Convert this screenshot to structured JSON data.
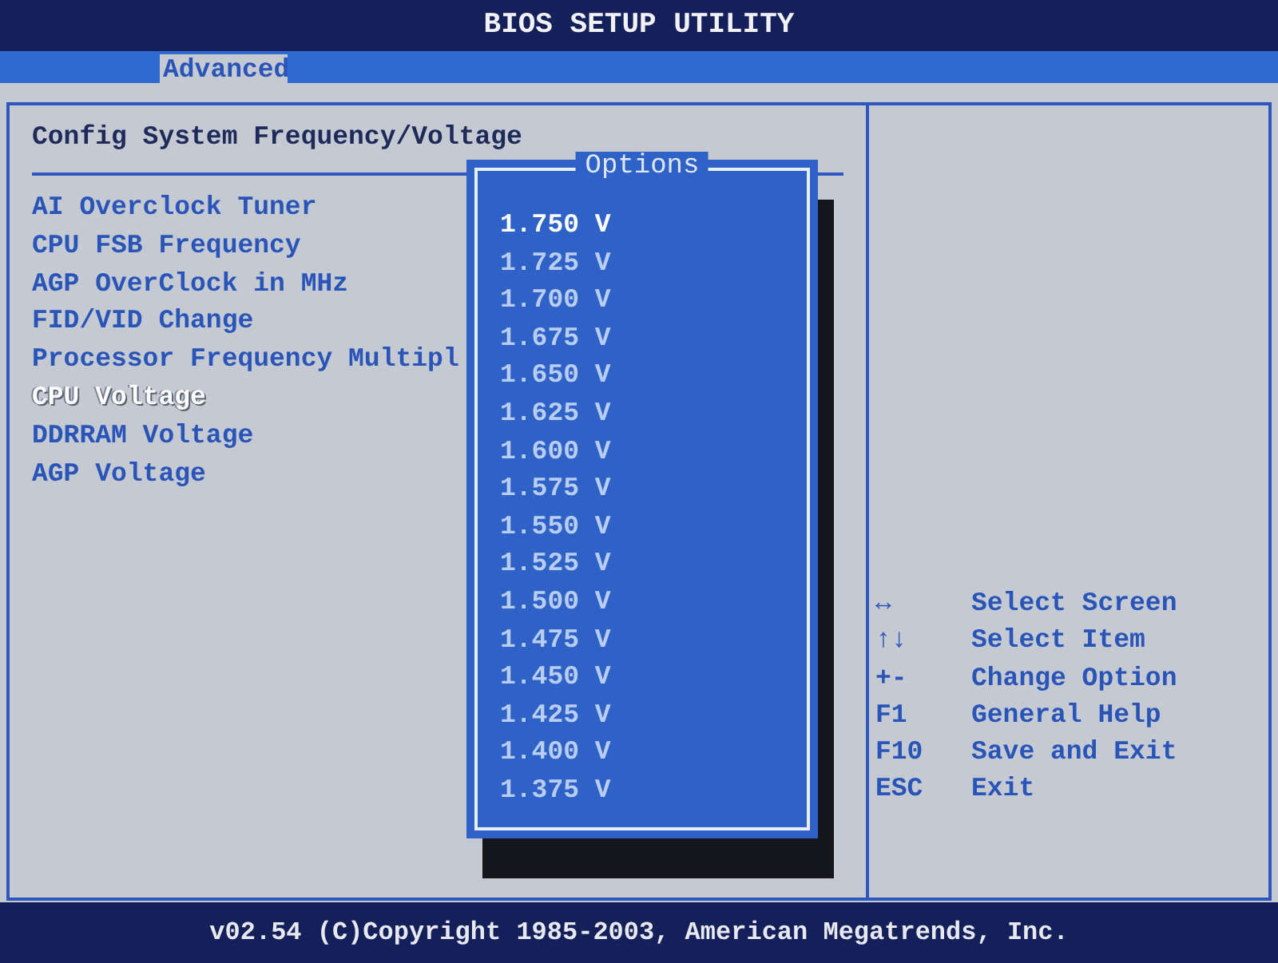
{
  "window": {
    "title": "BIOS SETUP UTILITY"
  },
  "tabs": [
    {
      "label": "Advanced",
      "selected": true
    }
  ],
  "section": {
    "title": "Config System Frequency/Voltage"
  },
  "menu_items": [
    {
      "label": "AI Overclock Tuner",
      "selected": false
    },
    {
      "label": "CPU FSB Frequency",
      "selected": false
    },
    {
      "label": "AGP OverClock in MHz",
      "selected": false
    },
    {
      "label": "FID/VID Change",
      "selected": false
    },
    {
      "label": "Processor Frequency Multipl",
      "selected": false
    },
    {
      "label": "CPU Voltage",
      "selected": true
    },
    {
      "label": "DDRRAM Voltage",
      "selected": false
    },
    {
      "label": "AGP Voltage",
      "selected": false
    }
  ],
  "options_popup": {
    "title": "Options",
    "options": [
      {
        "label": "1.750 V",
        "selected": true
      },
      {
        "label": "1.725 V",
        "selected": false
      },
      {
        "label": "1.700 V",
        "selected": false
      },
      {
        "label": "1.675 V",
        "selected": false
      },
      {
        "label": "1.650 V",
        "selected": false
      },
      {
        "label": "1.625 V",
        "selected": false
      },
      {
        "label": "1.600 V",
        "selected": false
      },
      {
        "label": "1.575 V",
        "selected": false
      },
      {
        "label": "1.550 V",
        "selected": false
      },
      {
        "label": "1.525 V",
        "selected": false
      },
      {
        "label": "1.500 V",
        "selected": false
      },
      {
        "label": "1.475 V",
        "selected": false
      },
      {
        "label": "1.450 V",
        "selected": false
      },
      {
        "label": "1.425 V",
        "selected": false
      },
      {
        "label": "1.400 V",
        "selected": false
      },
      {
        "label": "1.375 V",
        "selected": false
      }
    ]
  },
  "help": [
    {
      "key": "↔",
      "action": "Select Screen"
    },
    {
      "key": "↑↓",
      "action": "Select Item"
    },
    {
      "key": "+-",
      "action": "Change Option"
    },
    {
      "key": "F1",
      "action": "General Help"
    },
    {
      "key": "F10",
      "action": "Save and Exit"
    },
    {
      "key": "ESC",
      "action": "Exit"
    }
  ],
  "status_bar": {
    "text": "v02.54 (C)Copyright 1985-2003, American Megatrends, Inc."
  }
}
